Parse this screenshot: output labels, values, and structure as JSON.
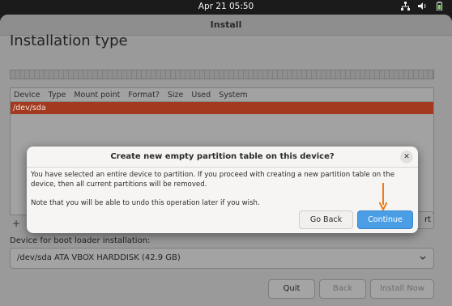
{
  "system_bar": {
    "clock": "Apr 21  05:50"
  },
  "window": {
    "title": "Install"
  },
  "page": {
    "title": "Installation type"
  },
  "partition_table": {
    "columns": [
      "Device",
      "Type",
      "Mount point",
      "Format?",
      "Size",
      "Used",
      "System"
    ],
    "rows": [
      {
        "device": "/dev/sda"
      }
    ],
    "add_label": "+",
    "revert_label": "rt"
  },
  "boot_loader": {
    "label": "Device for boot loader installation:",
    "selected": "/dev/sda ATA VBOX HARDDISK (42.9 GB)"
  },
  "buttons": {
    "quit": "Quit",
    "back": "Back",
    "install_now": "Install Now"
  },
  "dialog": {
    "title": "Create new empty partition table on this device?",
    "body_1": "You have selected an entire device to partition. If you proceed with creating a new partition table on the device, then all current partitions will be removed.",
    "body_2": "Note that you will be able to undo this operation later if you wish.",
    "go_back": "Go Back",
    "continue": "Continue",
    "close_glyph": "✕"
  },
  "colors": {
    "selection": "#a33a1f",
    "primary": "#4a9ee6",
    "arrow": "#ee7a1c"
  }
}
